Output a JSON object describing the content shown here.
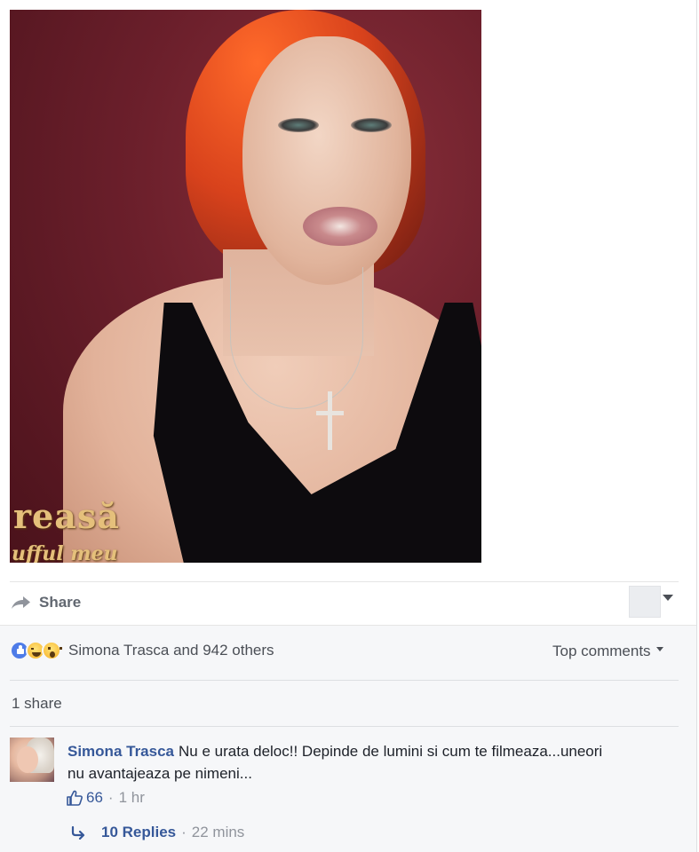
{
  "photo": {
    "watermark_line1": "reasă",
    "watermark_line2": "ufful meu"
  },
  "actions": {
    "share_label": "Share"
  },
  "feedback": {
    "reactions": [
      "like-icon",
      "haha-icon",
      "wow-icon"
    ],
    "reaction_summary": "Simona Trasca and 942 others",
    "sort_label": "Top comments",
    "share_count": "1 share"
  },
  "comment": {
    "author": "Simona Trasca",
    "text": "Nu e urata deloc!! Depinde de lumini si cum te filmeaza...uneori nu avantajeaza pe nimeni...",
    "like_count": "66",
    "timestamp": "1 hr",
    "replies_label": "10 Replies",
    "replies_timestamp": "22 mins"
  },
  "colors": {
    "link": "#365899",
    "muted": "#90949c",
    "panel_bg": "#f6f7f9",
    "like_blue": "#4e7ce8"
  }
}
